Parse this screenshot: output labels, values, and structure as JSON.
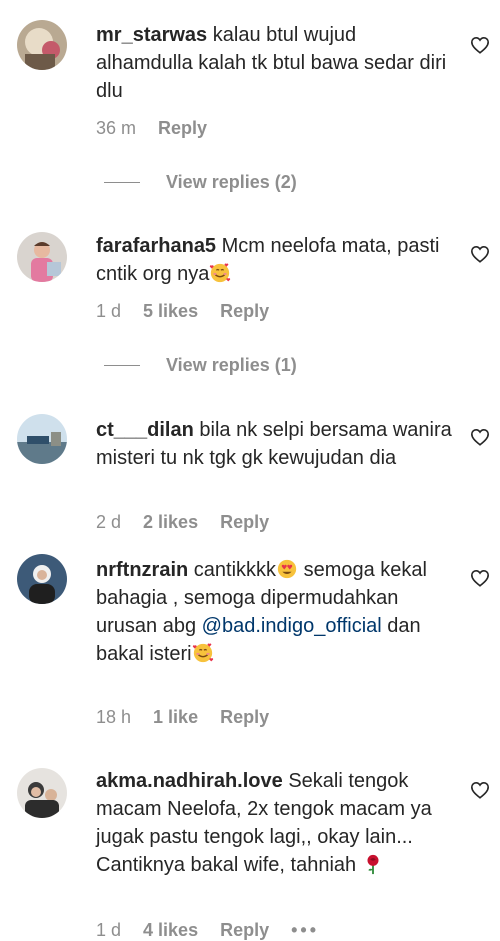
{
  "comments": [
    {
      "username": "mr_starwas",
      "text": "kalau btul wujud alhamdulla kalah tk btul bawa sedar diri dlu",
      "time": "36 m",
      "likes": "",
      "reply_label": "Reply",
      "view_replies": "View replies (2)"
    },
    {
      "username": "farafarhana5",
      "text": "Mcm neelofa mata, pasti cntik org nya",
      "emoji": "smiling-face-with-hearts",
      "time": "1 d",
      "likes": "5 likes",
      "reply_label": "Reply",
      "view_replies": "View replies (1)"
    },
    {
      "username": "ct___dilan",
      "text": "bila nk selpi bersama wanira misteri tu nk tgk gk kewujudan dia",
      "time": "2 d",
      "likes": "2 likes",
      "reply_label": "Reply"
    },
    {
      "username": "nrftnzrain",
      "text_before": "cantikkkk",
      "emoji_1": "heart-eyes",
      "text_middle": " semoga kekal bahagia , semoga dipermudahkan urusan abg ",
      "mention": "@bad.indigo_official",
      "text_after": " dan bakal isteri",
      "emoji_2": "smiling-face-with-hearts",
      "time": "18 h",
      "likes": "1 like",
      "reply_label": "Reply"
    },
    {
      "username": "akma.nadhirah.love",
      "text": "Sekali tengok macam Neelofa, 2x tengok macam ya jugak pastu tengok lagi,, okay lain... Cantiknya bakal wife, tahniah",
      "emoji": "rose",
      "time": "1 d",
      "likes": "4 likes",
      "reply_label": "Reply",
      "more_label": "•••"
    }
  ],
  "icons": {
    "like": "heart-outline-icon"
  },
  "colors": {
    "text": "#262626",
    "secondary": "#8e8e8e",
    "mention": "#00376b"
  }
}
